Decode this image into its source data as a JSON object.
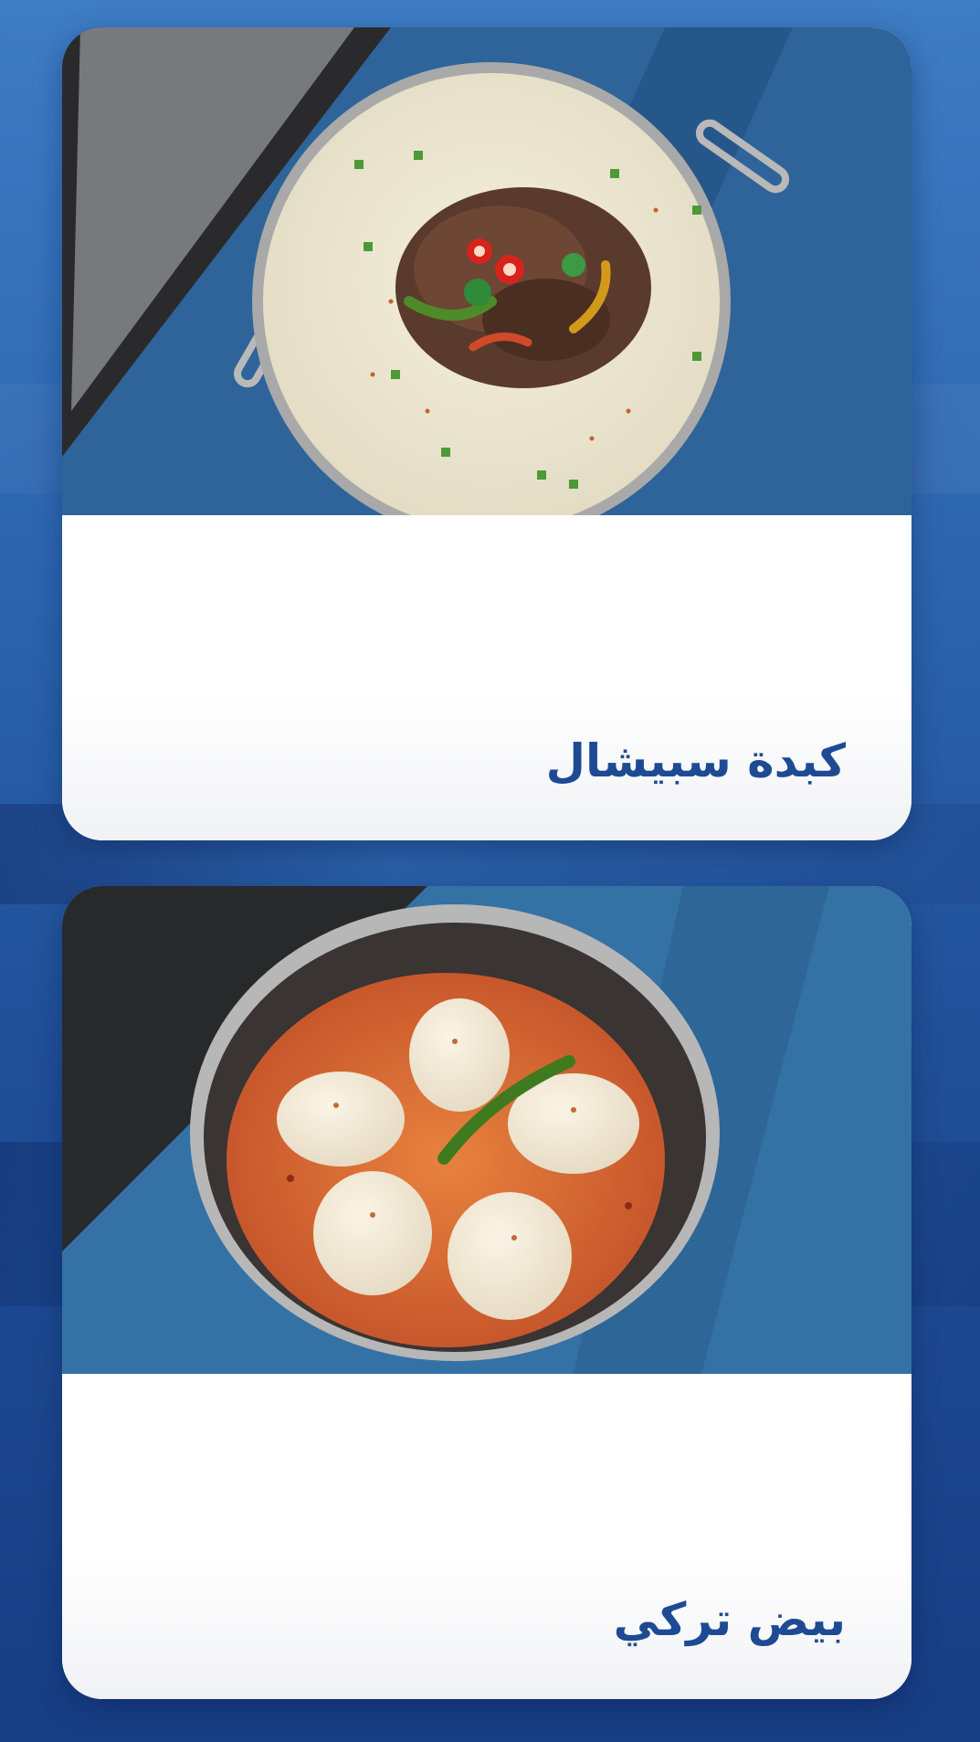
{
  "menu": {
    "items": [
      {
        "name": "كبدة سبيشال",
        "photo": "liver-in-creamy-sauce-with-peppers"
      },
      {
        "name": "بيض تركي",
        "photo": "eggs-in-tomato-pepper-sauce-with-green-chili"
      }
    ]
  },
  "colors": {
    "background": "#2b63ad",
    "card": "#ffffff",
    "title": "#1e4a94"
  }
}
